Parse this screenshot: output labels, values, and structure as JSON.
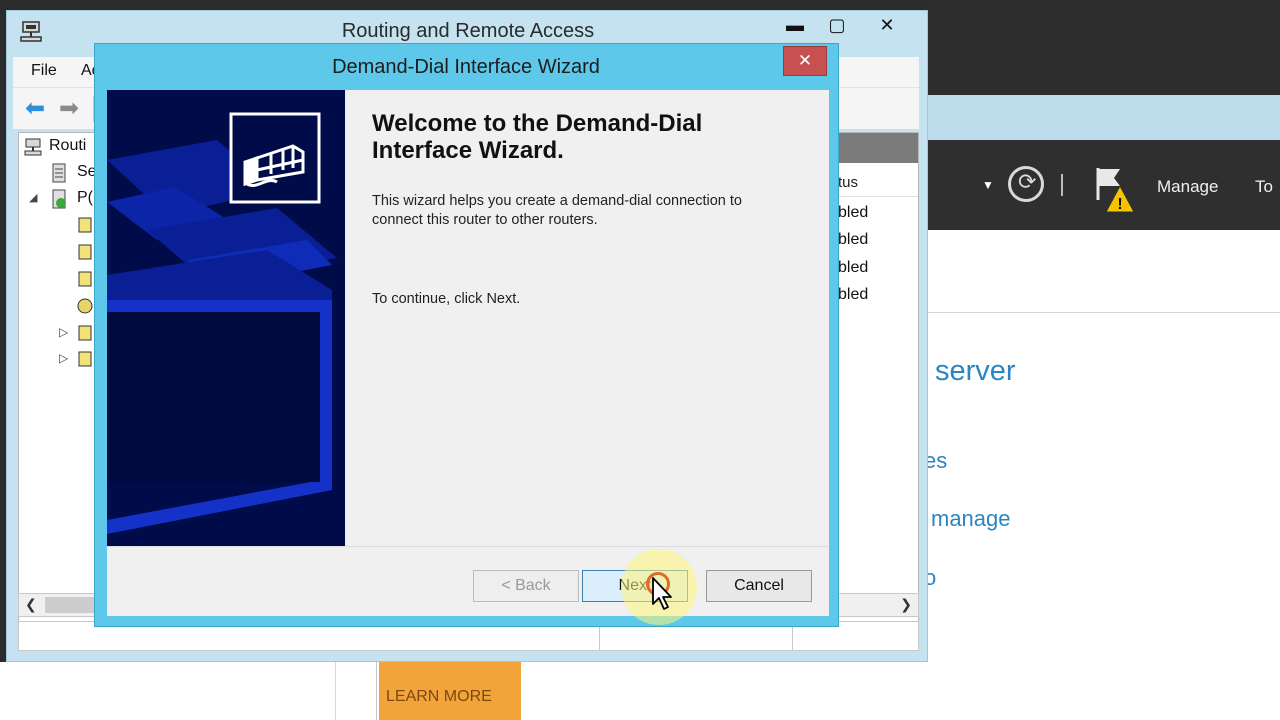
{
  "rras_window": {
    "title": "Routing and Remote Access",
    "controls": {
      "minimize": "▬",
      "maximize": "▢",
      "close": "✕"
    },
    "menu": {
      "file": "File",
      "action_partial": "Ac"
    },
    "tree": {
      "root_partial": "Routi",
      "server_status_partial": "Se",
      "server_partial": "P("
    },
    "list": {
      "status_header_partial": "tus",
      "status_cells_partial": [
        "bled",
        "bled",
        "bled",
        "bled"
      ]
    }
  },
  "wizard": {
    "title": "Demand-Dial Interface Wizard",
    "close_label": "✕",
    "heading": "Welcome to the Demand-Dial Interface Wizard.",
    "description": "This wizard helps you create a demand-dial connection to connect this router to other routers.",
    "continue_text": "To continue, click Next.",
    "buttons": {
      "back": "< Back",
      "next": "Next",
      "cancel": "Cancel"
    }
  },
  "server_manager": {
    "toolbar": {
      "manage": "Manage",
      "tools_partial": "To"
    },
    "content": {
      "line1_partial": "server",
      "line2_partial": "es",
      "line3_partial": "manage",
      "line4_partial": "o"
    },
    "learn_more": "LEARN MORE"
  },
  "colors": {
    "rras_frame": "#c5e2f0",
    "wizard_frame": "#5ec8ea",
    "wizard_close": "#c75050",
    "banner": "#000b4a",
    "next_button": "#dbeefc",
    "learn_more": "#f2a33a",
    "link_blue": "#2a86c2"
  }
}
